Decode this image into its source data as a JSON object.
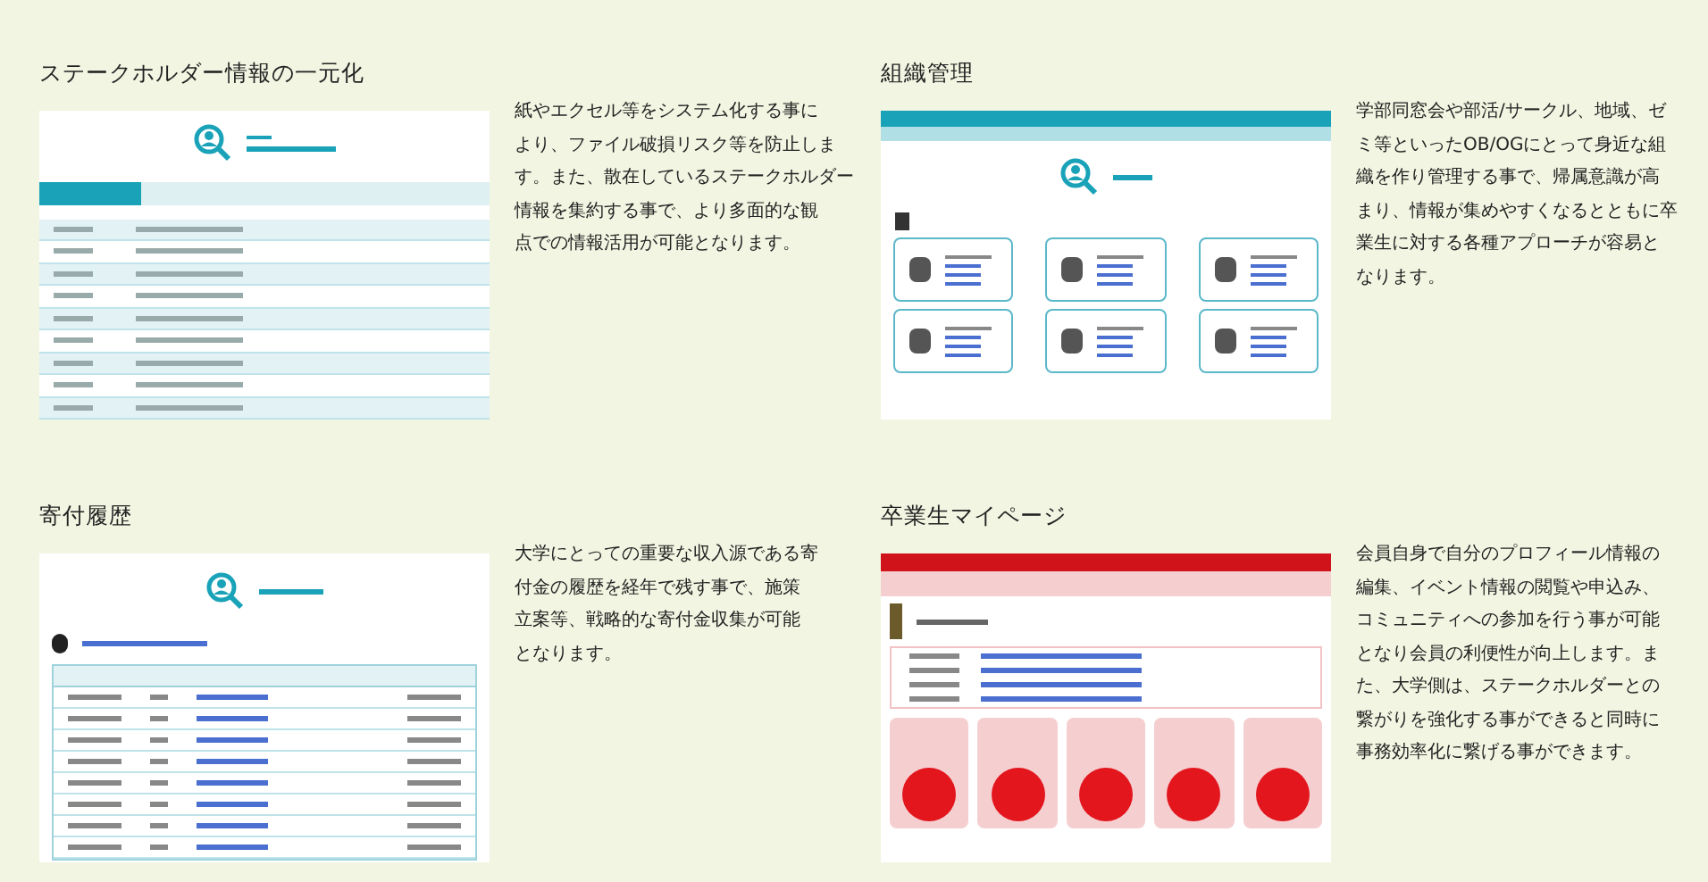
{
  "sections": [
    {
      "kind": "profile",
      "title": "ステークホルダー情報の一元化",
      "lines": [
        "紙やエクセル等をシステム化する事に",
        "より、ファイル破損リスク等を防止しま",
        "す。また、散在しているステークホルダー",
        "情報を集約する事で、より多面的な観",
        "点での情報活用が可能となります。"
      ]
    },
    {
      "kind": "organization",
      "title": "組織管理",
      "lines": [
        "学部同窓会や部活/サークル、地域、ゼ",
        "ミ等といったOB/OGにとって身近な組",
        "織を作り管理する事で、帰属意識が高",
        "まり、情報が集めやすくなるとともに卒",
        "業生に対する各種アプローチが容易と",
        "なります。"
      ]
    },
    {
      "kind": "donation",
      "title": "寄付履歴",
      "lines": [
        "大学にとっての重要な収入源である寄",
        "付金の履歴を経年で残す事で、施策",
        "立案等、戦略的な寄付金収集が可能",
        "となります。"
      ]
    },
    {
      "kind": "mypage",
      "title": "卒業生マイページ",
      "lines": [
        "会員自身で自分のプロフィール情報の",
        "編集、イベント情報の閲覧や申込み、",
        "コミュニティへの参加を行う事が可能",
        "となり会員の利便性が向上します。ま",
        "た、大学側は、ステークホルダーとの",
        "繋がりを強化する事ができると同時に",
        "事務効率化に繋げる事ができます。"
      ]
    }
  ]
}
